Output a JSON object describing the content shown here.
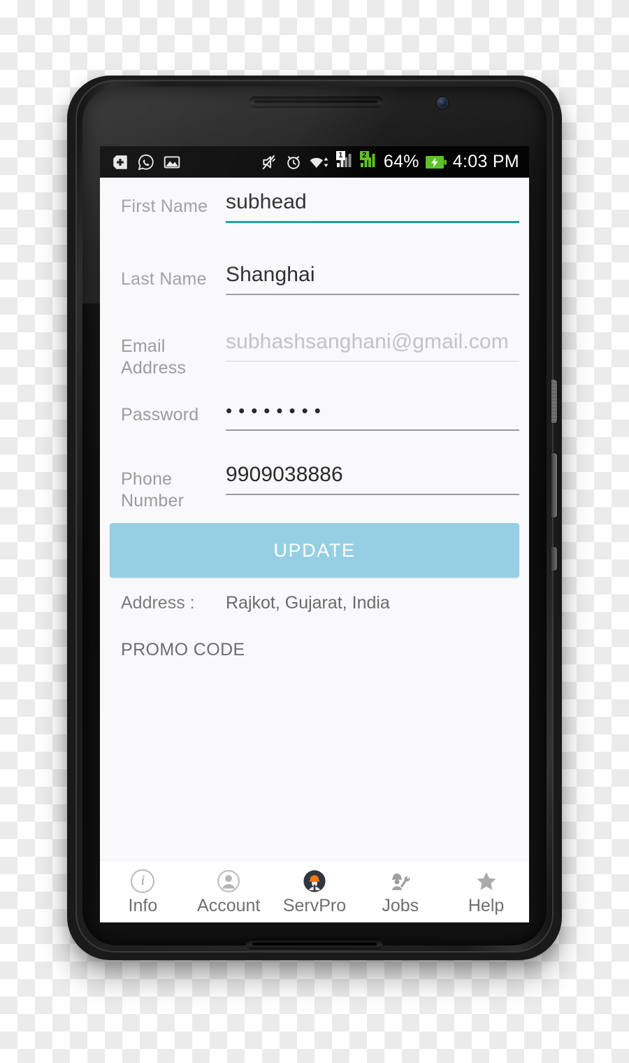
{
  "status_bar": {
    "left_icons": [
      "plus-box-icon",
      "whatsapp-icon",
      "gallery-icon"
    ],
    "right_icons": [
      "mute-icon",
      "alarm-icon",
      "wifi-icon",
      "signal-sim1-icon",
      "signal-sim2-icon"
    ],
    "sim1_label": "1",
    "sim2_label": "2",
    "battery_percent": "64%",
    "battery_icon": "battery-charging-icon",
    "clock": "4:03 PM"
  },
  "form": {
    "fields": [
      {
        "label": "First Name",
        "value": "subhead",
        "placeholder": "First Name",
        "state": "focused",
        "type": "text"
      },
      {
        "label": "Last Name",
        "value": "Shanghai",
        "placeholder": "Last Name",
        "state": "normal",
        "type": "text"
      },
      {
        "label": "Email Address",
        "value": "subhashsanghani@gmail.com",
        "placeholder": "Email Address",
        "state": "disabled",
        "type": "email"
      },
      {
        "label": "Password",
        "value": "••••••••",
        "placeholder": "Password",
        "state": "normal",
        "type": "password"
      },
      {
        "label": "Phone Number",
        "value": "9909038886",
        "placeholder": "Phone Number",
        "state": "normal",
        "type": "tel"
      }
    ],
    "update_button_label": "UPDATE",
    "address_label": "Address :",
    "address_value": "Rajkot, Gujarat, India",
    "promo_code_label": "PROMO CODE"
  },
  "bottom_nav": {
    "items": [
      {
        "label": "Info",
        "icon": "info-circle-icon"
      },
      {
        "label": "Account",
        "icon": "person-circle-icon"
      },
      {
        "label": "ServPro",
        "icon": "servpro-worker-icon"
      },
      {
        "label": "Jobs",
        "icon": "worker-wrench-icon"
      },
      {
        "label": "Help",
        "icon": "star-icon"
      }
    ]
  },
  "colors": {
    "accent_focus": "#17a198",
    "update_button": "#96cfe3",
    "screen_background": "#f9f8fb",
    "label_text": "#9c9c9c",
    "status_bar_background": "#040404",
    "signal_sim2": "#5ec12a",
    "servpro_helmet": "#f07818"
  }
}
